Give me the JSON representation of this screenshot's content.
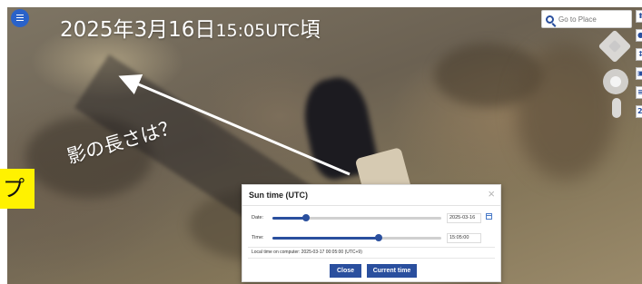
{
  "headline": {
    "date_text": "2025年3月16日",
    "time_text": "15:05UTC",
    "suffix": "頃"
  },
  "search": {
    "placeholder": "Go to Place"
  },
  "annotation": {
    "question": "影の長さは？",
    "tag_text": "プ"
  },
  "toolbar": {
    "items": [
      "⬆",
      "●",
      "↕",
      "▣",
      "≡",
      "2"
    ]
  },
  "dialog": {
    "title": "Sun time (UTC)",
    "close_symbol": "×",
    "date_label": "Date:",
    "date_value": "2025-03-16",
    "date_slider_fraction": 0.2,
    "time_label": "Time:",
    "time_value": "15:05:00",
    "time_slider_fraction": 0.63,
    "local_time_text": "Local time on computer: 2025-03-17 00:05:00 (UTC+9)",
    "close_button": "Close",
    "current_time_button": "Current time"
  },
  "colors": {
    "accent": "#2a4f9e",
    "menu_button": "#2a62c9",
    "tag_yellow": "#fff200"
  }
}
